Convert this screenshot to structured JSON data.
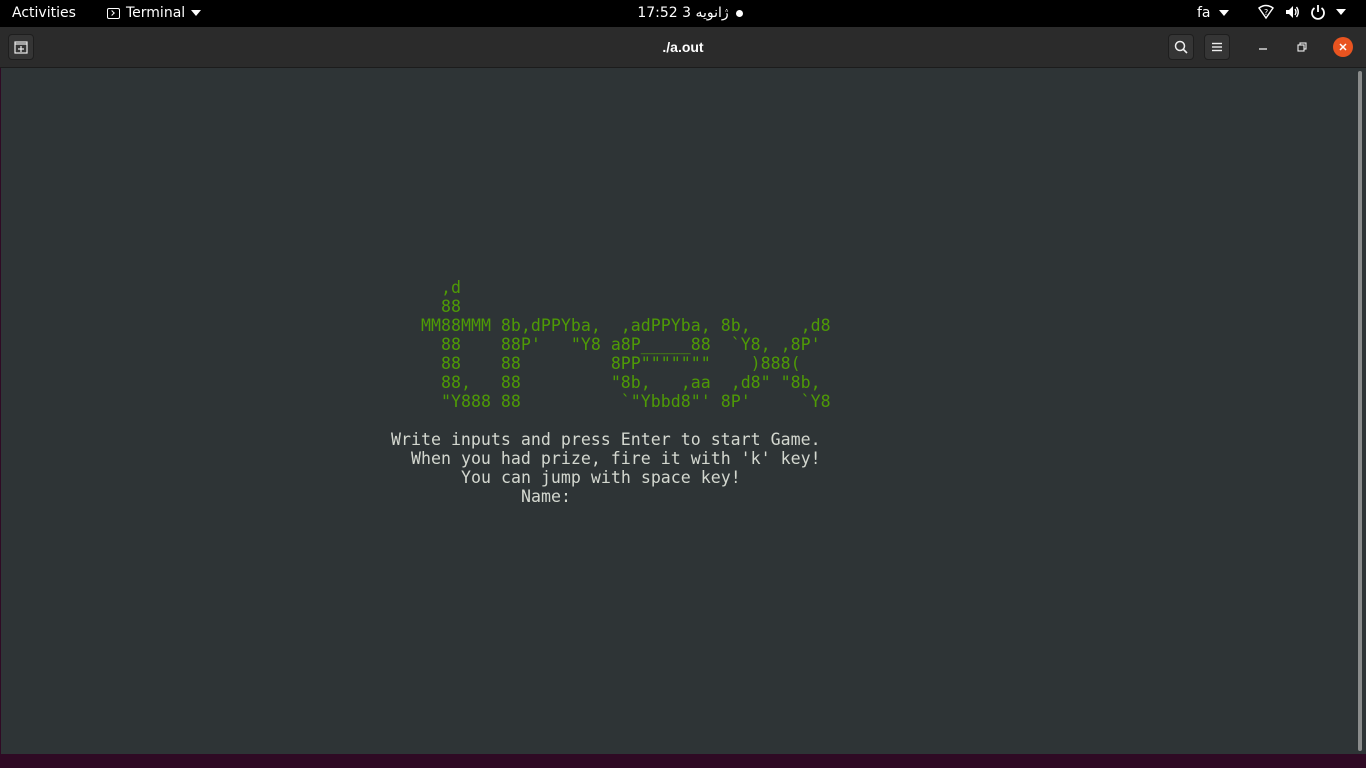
{
  "topbar": {
    "activities": "Activities",
    "app_name": "Terminal",
    "clock": "17:52  ژانویه 3",
    "keyboard_layout": "fa"
  },
  "window": {
    "title": "./a.out"
  },
  "terminal": {
    "banner_lines": [
      "  ,d",
      "  88",
      "MM88MMM 8b,dPPYba,  ,adPPYba, 8b,     ,d8",
      "  88    88P'   \"Y8 a8P_____88  `Y8, ,8P'",
      "  88    88         8PP\"\"\"\"\"\"\"    )888(",
      "  88,   88         \"8b,   ,aa  ,d8\" \"8b,",
      "  \"Y888 88          `\"Ybbd8\"' 8P'     `Y8"
    ],
    "messages": [
      "Write inputs and press Enter to start Game.",
      "When you had prize, fire it with 'k' key!",
      "You can jump with space key!",
      "Name:"
    ]
  },
  "colors": {
    "banner": "#4e9a06",
    "text": "#d3d7cf",
    "terminal_bg": "#2e3436",
    "close_button": "#e95420"
  }
}
